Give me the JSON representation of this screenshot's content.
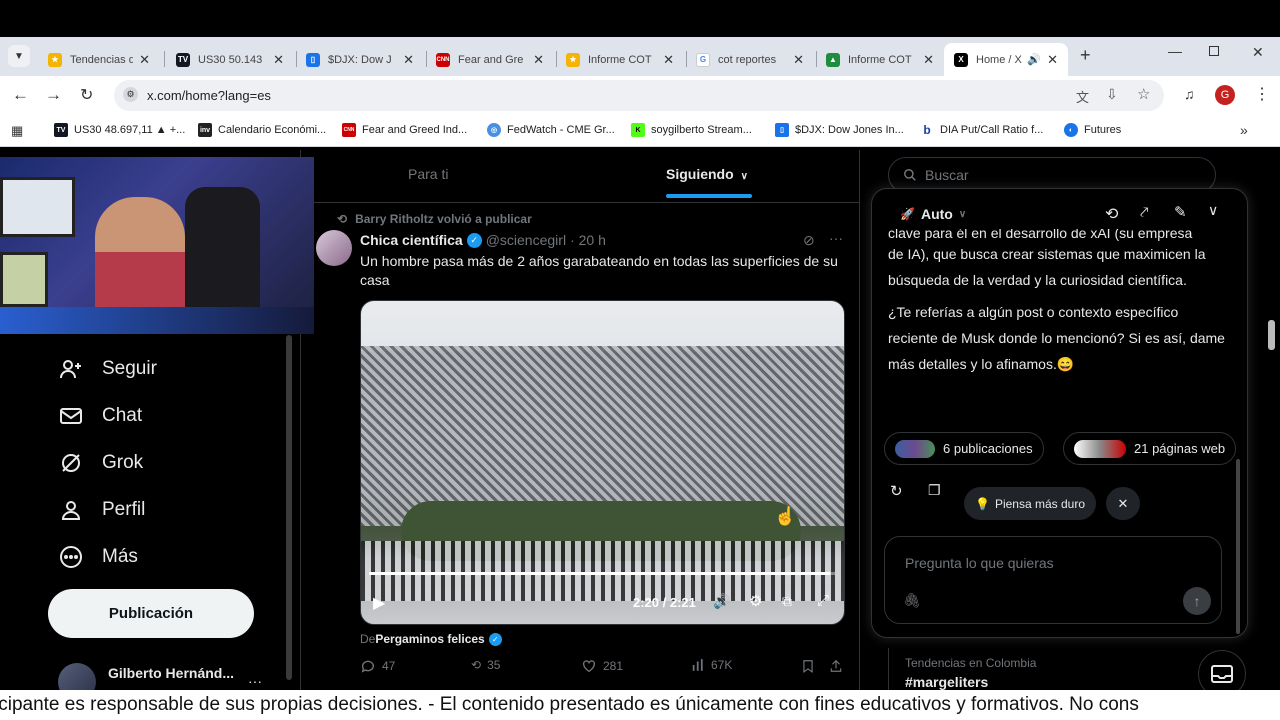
{
  "browser": {
    "tabs": [
      {
        "label": "Tendencias d",
        "fav_color": "#f4b400",
        "fav": "★"
      },
      {
        "label": "US30 50.143",
        "fav_color": "#131722",
        "fav": "TV"
      },
      {
        "label": "$DJX: Dow J",
        "fav_color": "#1a73e8",
        "fav": "▯"
      },
      {
        "label": "Fear and Gre",
        "fav_color": "#cc0000",
        "fav": "CNN"
      },
      {
        "label": "Informe COT",
        "fav_color": "#f4b400",
        "fav": "★"
      },
      {
        "label": "cot reportes",
        "fav_color": "#ffffff",
        "fav": "G"
      },
      {
        "label": "Informe COT",
        "fav_color": "#1e8e3e",
        "fav": "▲"
      },
      {
        "label": "Home / X",
        "fav_color": "#000000",
        "fav": "X"
      }
    ],
    "url": "x.com/home?lang=es",
    "bookmarks": [
      {
        "label": "US30 48.697,11 ▲ +...",
        "fav_color": "#131722",
        "fav": "TV"
      },
      {
        "label": "Calendario Económi...",
        "fav_color": "#222",
        "fav": "inv"
      },
      {
        "label": "Fear and Greed Ind...",
        "fav_color": "#cc0000",
        "fav": "CNN"
      },
      {
        "label": "FedWatch - CME Gr...",
        "fav_color": "#4a90e2",
        "fav": "◎"
      },
      {
        "label": "soygilberto Stream...",
        "fav_color": "#53fc18",
        "fav": "K"
      },
      {
        "label": "$DJX: Dow Jones In...",
        "fav_color": "#1a73e8",
        "fav": "▯"
      },
      {
        "label": "DIA Put/Call Ratio f...",
        "fav_color": "#ffffff",
        "fav": "b"
      },
      {
        "label": "Futures",
        "fav_color": "#1a73e8",
        "fav": "◐"
      }
    ],
    "avatar_letter": "G"
  },
  "nav": {
    "follow": "Seguir",
    "chat": "Chat",
    "grok": "Grok",
    "profile": "Perfil",
    "more": "Más",
    "post_button": "Publicación",
    "user_name": "Gilberto Hernánd...",
    "user_more": "···"
  },
  "timeline": {
    "tab_for_you": "Para ti",
    "tab_following": "Siguiendo",
    "repost_note": "Barry Ritholtz volvió a publicar",
    "author": "Chica científica",
    "handle": "@sciencegirl",
    "time": "· 20 h",
    "text": "Un hombre pasa más de 2 años garabateando en todas las superficies de su casa",
    "video_time": "2:20 / 2:21",
    "video_progress": 0.99,
    "credit_prefix": "De",
    "credit_name": "Pergaminos felices",
    "replies": "47",
    "reposts": "35",
    "likes": "281",
    "views": "67K"
  },
  "search": {
    "placeholder": "Buscar"
  },
  "grok": {
    "mode": "Auto",
    "line0": "clave para él en el desarrollo de xAI (su empresa",
    "paragraph1": "de IA), que busca crear sistemas que maximicen la búsqueda de la verdad y la curiosidad científica.",
    "paragraph2": "¿Te referías a algún post o contexto específico reciente de Musk donde lo mencionó? Si es así, dame más detalles y lo afinamos.😄",
    "posts_pill": "6 publicaciones",
    "web_pill": "21 páginas web",
    "think_harder": "Piensa más duro",
    "ask_placeholder": "Pregunta lo que quieras"
  },
  "trends": {
    "label": "Tendencias en Colombia",
    "tag": "#margeliters"
  },
  "caption": "icipante es responsable de sus propias decisiones.  - El contenido presentado es únicamente con fines educativos y formativos. No cons"
}
